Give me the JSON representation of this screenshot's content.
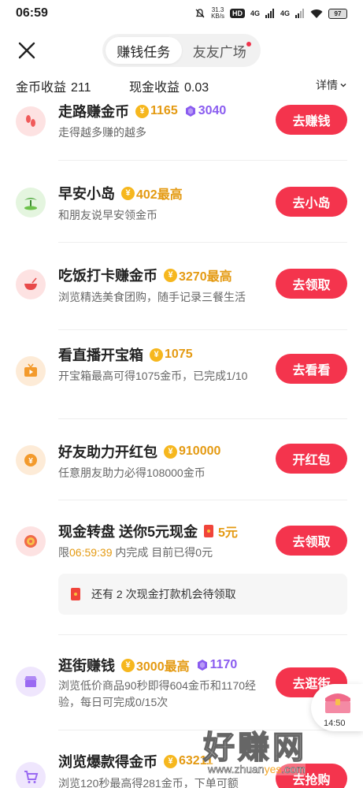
{
  "status_bar": {
    "time": "06:59",
    "net_speed_top": "31.3",
    "net_speed_bottom": "KB/s",
    "hd_label": "HD",
    "sig1_label": "4G",
    "sig2_label": "4G",
    "battery": "97"
  },
  "header": {
    "tabs": [
      {
        "label": "赚钱任务",
        "active": true
      },
      {
        "label": "友友广场",
        "active": false,
        "has_dot": true
      }
    ]
  },
  "summary": {
    "coin_label": "金币收益",
    "coin_value": "211",
    "cash_label": "现金收益",
    "cash_value": "0.03",
    "detail_label": "详情"
  },
  "tasks": [
    {
      "title": "走路赚金币",
      "coin_reward": "1165",
      "exp_reward": "3040",
      "desc": "走得越多赚的越多",
      "button": "去赚钱",
      "icon": "footprints-icon"
    },
    {
      "title": "早安小岛",
      "coin_reward": "402最高",
      "desc": "和朋友说早安领金币",
      "button": "去小岛",
      "icon": "island-icon"
    },
    {
      "title": "吃饭打卡赚金币",
      "coin_reward": "3270最高",
      "desc": "浏览精选美食团购，随手记录三餐生活",
      "button": "去领取",
      "icon": "bowl-icon"
    },
    {
      "title": "看直播开宝箱",
      "coin_reward": "1075",
      "desc": "开宝箱最高可得1075金币，已完成1/10",
      "button": "去看看",
      "icon": "live-tv-icon"
    },
    {
      "title": "好友助力开红包",
      "coin_reward": "910000",
      "desc": "任意朋友助力必得108000金币",
      "button": "开红包",
      "icon": "yuan-coin-icon"
    },
    {
      "title": "现金转盘 送你5元现金",
      "cash_reward": "5元",
      "desc_prefix": "限",
      "desc_time": "06:59:39",
      "desc_suffix": " 内完成 目前已得0元",
      "button": "去领取",
      "icon": "wheel-icon"
    },
    {
      "title": "逛街赚钱",
      "coin_reward": "3000最高",
      "exp_reward": "1170",
      "desc": "浏览低价商品90秒即得604金币和1170经验，每日可完成0/15次",
      "button": "去逛街",
      "icon": "shop-icon"
    },
    {
      "title": "浏览爆款得金币",
      "coin_reward": "63211",
      "desc": "浏览120秒最高得281金币，下单可额",
      "button": "去抢购",
      "icon": "cart-icon"
    }
  ],
  "info_box": {
    "text": "还有 2 次现金打款机会待领取"
  },
  "floating_chest": {
    "time": "14:50"
  },
  "watermark": {
    "title": "好赚网",
    "url_prefix": "www.zhuan",
    "url_highlight": "yes",
    "url_suffix": ".com"
  },
  "colors": {
    "accent_red": "#f4344d",
    "coin_gold": "#e49a12",
    "exp_purple": "#8a5cf0"
  }
}
